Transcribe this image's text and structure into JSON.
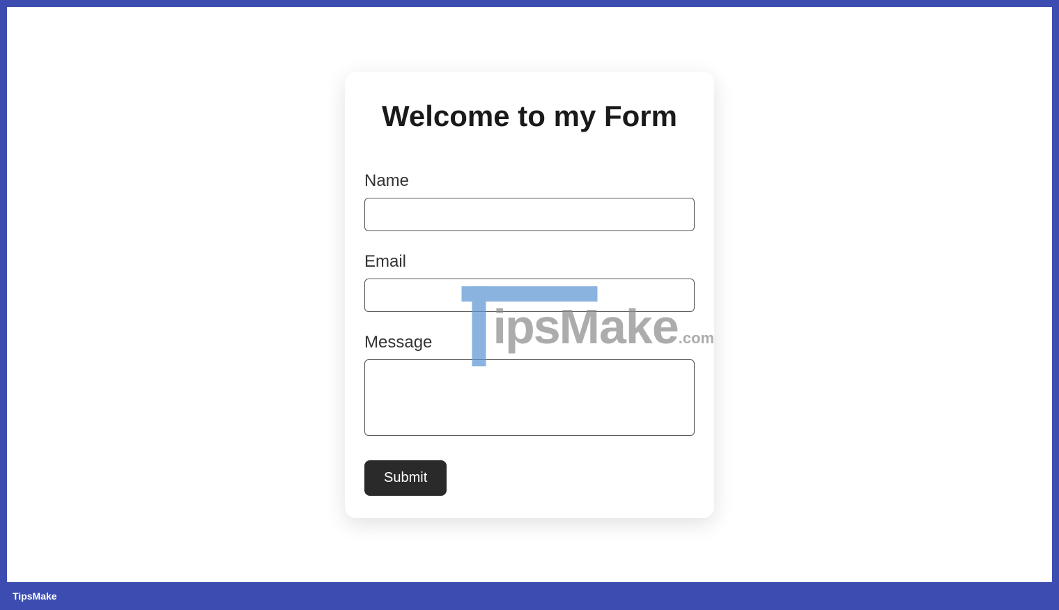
{
  "form": {
    "title": "Welcome to my Form",
    "fields": {
      "name": {
        "label": "Name",
        "value": ""
      },
      "email": {
        "label": "Email",
        "value": ""
      },
      "message": {
        "label": "Message",
        "value": ""
      }
    },
    "submit_label": "Submit"
  },
  "watermark": {
    "text_part1": "ips",
    "text_part2": "Make",
    "text_suffix": ".com"
  },
  "footer": {
    "brand": "TipsMake"
  }
}
